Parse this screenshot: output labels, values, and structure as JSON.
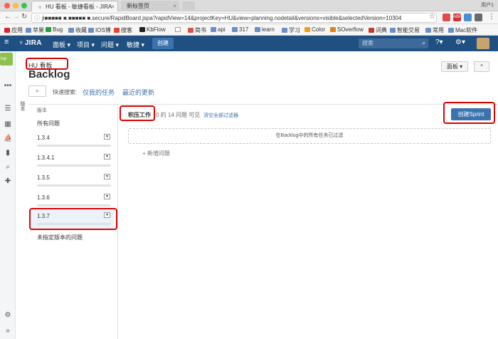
{
  "browser": {
    "tabs": [
      {
        "title": "HU 看板 - 敏捷看板 - JIRA",
        "active": true
      },
      {
        "title": "新标签页",
        "active": false
      }
    ],
    "user_label": "用户1",
    "url": "ji■■■■■ ■.■■■■■ ■.secure/RapidBoard.jspa?rapidView=14&projectKey=HU&view=planning.nodetail&versions=visible&selectedVersion=10304",
    "bookmarks": [
      "应用",
      "苹果",
      "Bug",
      "收藏",
      "IOS博",
      "搜客",
      "KbFlow",
      "",
      "简书",
      "api",
      "317",
      "learn",
      "学习",
      "Color",
      "SOverflow",
      "词典",
      "智能交易",
      "常用",
      "Mac软件"
    ],
    "extensions": [
      {
        "label": "",
        "color": "#e24b4b"
      },
      {
        "label": "ABP",
        "color": "#d3332e"
      },
      {
        "label": "",
        "color": "#4a8fd9"
      },
      {
        "label": "",
        "color": "#6a6a6a"
      }
    ]
  },
  "header": {
    "logo": "JIRA",
    "menu": [
      "面板",
      "项目",
      "问题",
      "敏捷"
    ],
    "create": "创建",
    "search_placeholder": "搜索"
  },
  "appbar": {
    "project_label": "top"
  },
  "page": {
    "breadcrumb": "HU 看板",
    "title": "Backlog",
    "board_button": "面板",
    "collapse_button": "^",
    "vertical_label": "版本"
  },
  "quick_filters": {
    "label": "快速搜索:",
    "links": [
      "仅我的任务",
      "最近的更新"
    ]
  },
  "versions": {
    "heading": "版本",
    "all": "所有问题",
    "items": [
      {
        "name": "1.3.4",
        "selected": false
      },
      {
        "name": "1.3.4.1",
        "selected": false
      },
      {
        "name": "1.3.5",
        "selected": false
      },
      {
        "name": "1.3.6",
        "selected": false
      },
      {
        "name": "1.3.7",
        "selected": true
      }
    ],
    "unassigned": "未指定版本的问题"
  },
  "backlog": {
    "title": "积压工作",
    "count": "0 的 14 问题 可见",
    "clear": "清空全部过滤器",
    "create_sprint": "创建Sprint",
    "filtered_message": "在Backlog中的所有任务已过滤",
    "new_issue": "+ 新增问题"
  }
}
